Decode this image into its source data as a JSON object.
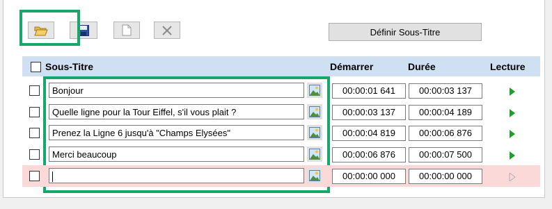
{
  "toolbar": {
    "buttons": [
      {
        "name": "open-button",
        "icon": "folder-open-icon"
      },
      {
        "name": "save-button",
        "icon": "floppy-disk-icon"
      },
      {
        "name": "new-button",
        "icon": "blank-page-icon"
      },
      {
        "name": "delete-button",
        "icon": "x-delete-icon"
      }
    ],
    "define_label": "Définir Sous-Titre"
  },
  "table": {
    "headers": {
      "subtitle": "Sous-Titre",
      "start": "Démarrer",
      "duration": "Durée",
      "play": "Lecture"
    },
    "rows": [
      {
        "text": "Bonjour",
        "start": "00:00:01 641",
        "duration": "00:00:03 137"
      },
      {
        "text": "Quelle ligne pour la Tour Eiffel, s'il vous plait ?",
        "start": "00:00:03 137",
        "duration": "00:00:04 189"
      },
      {
        "text": "Prenez la Ligne 6 jusqu'à \"Champs Elysées\"",
        "start": "00:00:04 819",
        "duration": "00:00:06 876"
      },
      {
        "text": "Merci beaucoup",
        "start": "00:00:06 876",
        "duration": "00:00:07 500"
      }
    ],
    "new_row": {
      "text": "",
      "start": "00:00:00 000",
      "duration": "00:00:00 000"
    }
  },
  "colors": {
    "highlight": "#17a869",
    "header_bg": "#cfe0f2",
    "new_row_bg": "#fcd9d9",
    "play_green": "#1e9e2a"
  }
}
